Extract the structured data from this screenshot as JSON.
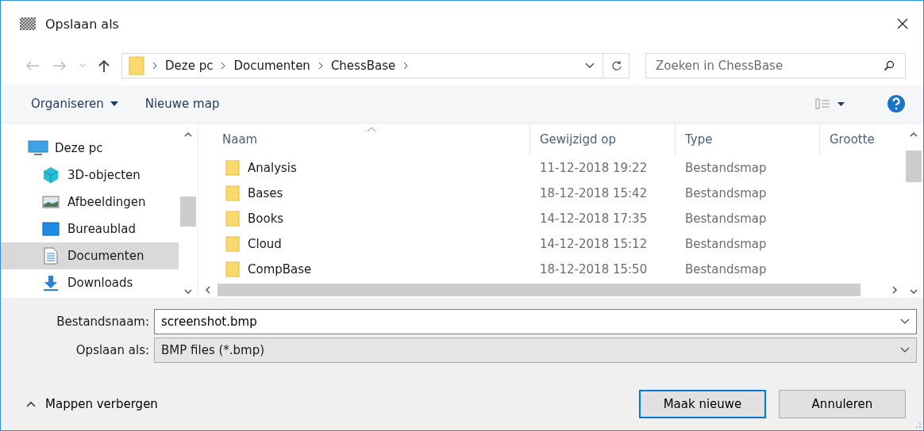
{
  "window": {
    "title": "Opslaan als"
  },
  "address": {
    "crumbs": [
      "Deze pc",
      "Documenten",
      "ChessBase"
    ]
  },
  "search": {
    "placeholder": "Zoeken in ChessBase"
  },
  "toolbar": {
    "organize": "Organiseren",
    "new_folder": "Nieuwe map"
  },
  "sidebar": {
    "items": [
      {
        "label": "Deze pc",
        "kind": "pc",
        "selected": false,
        "children": [
          {
            "label": "3D-objecten",
            "kind": "cube",
            "selected": false
          },
          {
            "label": "Afbeeldingen",
            "kind": "picture",
            "selected": false
          },
          {
            "label": "Bureaublad",
            "kind": "desktop",
            "selected": false
          },
          {
            "label": "Documenten",
            "kind": "document",
            "selected": true
          },
          {
            "label": "Downloads",
            "kind": "download",
            "selected": false
          }
        ]
      }
    ]
  },
  "table": {
    "columns": [
      "Naam",
      "Gewijzigd op",
      "Type",
      "Grootte"
    ],
    "rows": [
      {
        "name": "Analysis",
        "modified": "11-12-2018 19:22",
        "type": "Bestandsmap"
      },
      {
        "name": "Bases",
        "modified": "18-12-2018 15:42",
        "type": "Bestandsmap"
      },
      {
        "name": "Books",
        "modified": "14-12-2018 17:35",
        "type": "Bestandsmap"
      },
      {
        "name": "Cloud",
        "modified": "14-12-2018 15:12",
        "type": "Bestandsmap"
      },
      {
        "name": "CompBase",
        "modified": "18-12-2018 15:50",
        "type": "Bestandsmap"
      }
    ]
  },
  "form": {
    "filename_label": "Bestandsnaam:",
    "filename": "screenshot.bmp",
    "filetype_label": "Opslaan als:",
    "filetype": "BMP files (*.bmp)"
  },
  "footer": {
    "toggle": "Mappen verbergen",
    "buttons": [
      {
        "label": "Maak nieuwe",
        "selected": true
      },
      {
        "label": "Annuleren",
        "selected": false
      }
    ]
  }
}
